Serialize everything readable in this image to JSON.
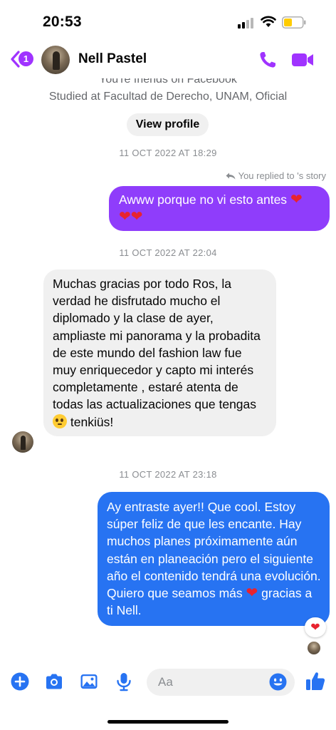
{
  "status_bar": {
    "time": "20:53"
  },
  "header": {
    "back_badge": "1",
    "contact_name": "Nell Pastel"
  },
  "profile_info": {
    "friends_line": "You're friends on Facebook",
    "education_line": "Studied at Facultad de Derecho, UNAM, Oficial",
    "view_profile_label": "View profile"
  },
  "messages": [
    {
      "timestamp": "11 OCT 2022 AT 18:29"
    },
    {
      "reply_note": "You replied to 's story",
      "text": "Awww porque no vi esto antes ",
      "hearts": "❤️❤️❤️"
    },
    {
      "timestamp": "11 OCT 2022 AT 22:04",
      "text": "Muchas gracias por todo Ros, la verdad he disfrutado mucho el diplomado y la clase de ayer, ampliaste mi panorama y la probadita de este mundo del fashion law fue muy enriquecedor y capto mi interés completamente , estaré atenta de todas las actualizaciones que tengas",
      "text_end": "tenkiüs!"
    },
    {
      "timestamp": "11 OCT 2022 AT 23:18",
      "text_start": "Ay entraste ayer!! Que cool. Estoy súper feliz de que les encante. Hay muchos planes próximamente   aún están en planeación pero el siguiente año el contenido tendrá una evolución. Quiero que seamos más",
      "text_end": "gracias a ti Nell.",
      "reaction": "❤️"
    }
  ],
  "composer": {
    "placeholder": "Aa"
  },
  "colors": {
    "accent": "#a033ff",
    "outgoing_purple": "#8f3dfb",
    "outgoing_blue": "#2773f2",
    "incoming_gray": "#f0f0f0"
  },
  "icons": [
    "signal-icon",
    "wifi-icon",
    "battery-icon",
    "back-chevron-icon",
    "phone-icon",
    "video-camera-icon",
    "reply-arrow-icon",
    "plus-icon",
    "camera-icon",
    "image-icon",
    "microphone-icon",
    "emoji-icon",
    "thumbs-up-icon"
  ]
}
